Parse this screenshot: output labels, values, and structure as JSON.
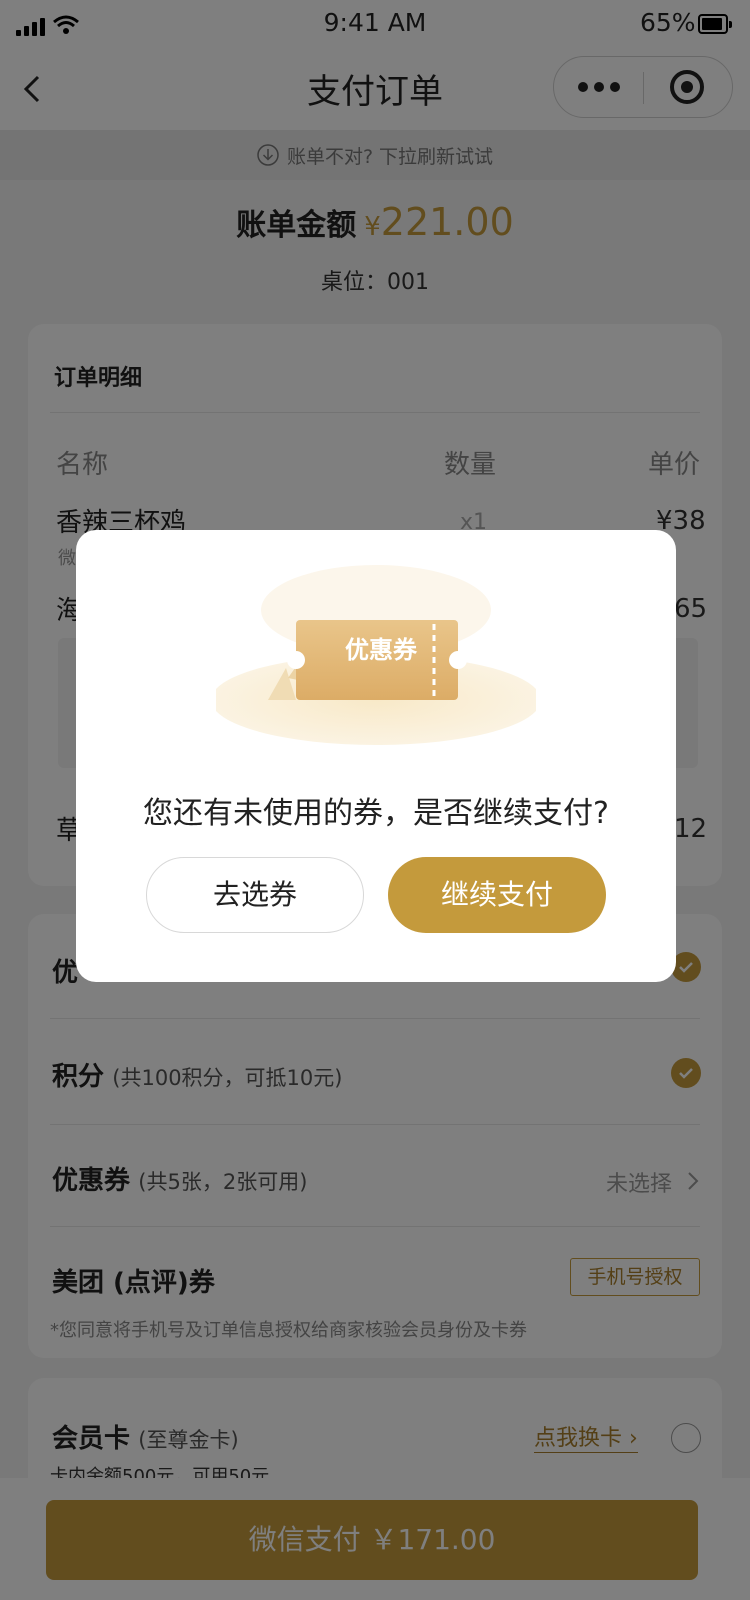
{
  "status_bar": {
    "time": "9:41 AM",
    "battery": "65%"
  },
  "nav": {
    "title": "支付订单"
  },
  "refresh_hint": "账单不对? 下拉刷新试试",
  "bill": {
    "label": "账单金额",
    "currency": "¥",
    "amount": "221.00",
    "table": "桌位：001"
  },
  "order": {
    "title": "订单明细",
    "columns": [
      "名称",
      "数量",
      "单价"
    ],
    "items": [
      {
        "name": "香辣三杯鸡",
        "sub": "微",
        "qty": "x1",
        "price": "¥38"
      },
      {
        "name": "海",
        "sub": "",
        "qty": "",
        "price": "65"
      },
      {
        "name": "草",
        "sub": "",
        "qty": "",
        "price": "12"
      }
    ]
  },
  "discounts": {
    "row1_title": "优",
    "points_title": "积分",
    "points_detail": "(共100积分，可抵10元)",
    "coupon_title": "优惠券",
    "coupon_detail": "(共5张，2张可用)",
    "coupon_status": "未选择",
    "meituan_title": "美团 (点评)券",
    "auth_button": "手机号授权",
    "auth_note": "*您同意将手机号及订单信息授权给商家核验会员身份及卡券"
  },
  "member": {
    "title": "会员卡",
    "detail": "(至尊金卡)",
    "swap_link": "点我换卡",
    "balance": "卡内余额500元，可用50元"
  },
  "pay_button": "微信支付 ￥171.00",
  "modal": {
    "coupon_label": "优惠券",
    "message": "您还有未使用的券，是否继续支付?",
    "choose_button": "去选券",
    "continue_button": "继续支付"
  },
  "colors": {
    "accent": "#c49a3c"
  }
}
